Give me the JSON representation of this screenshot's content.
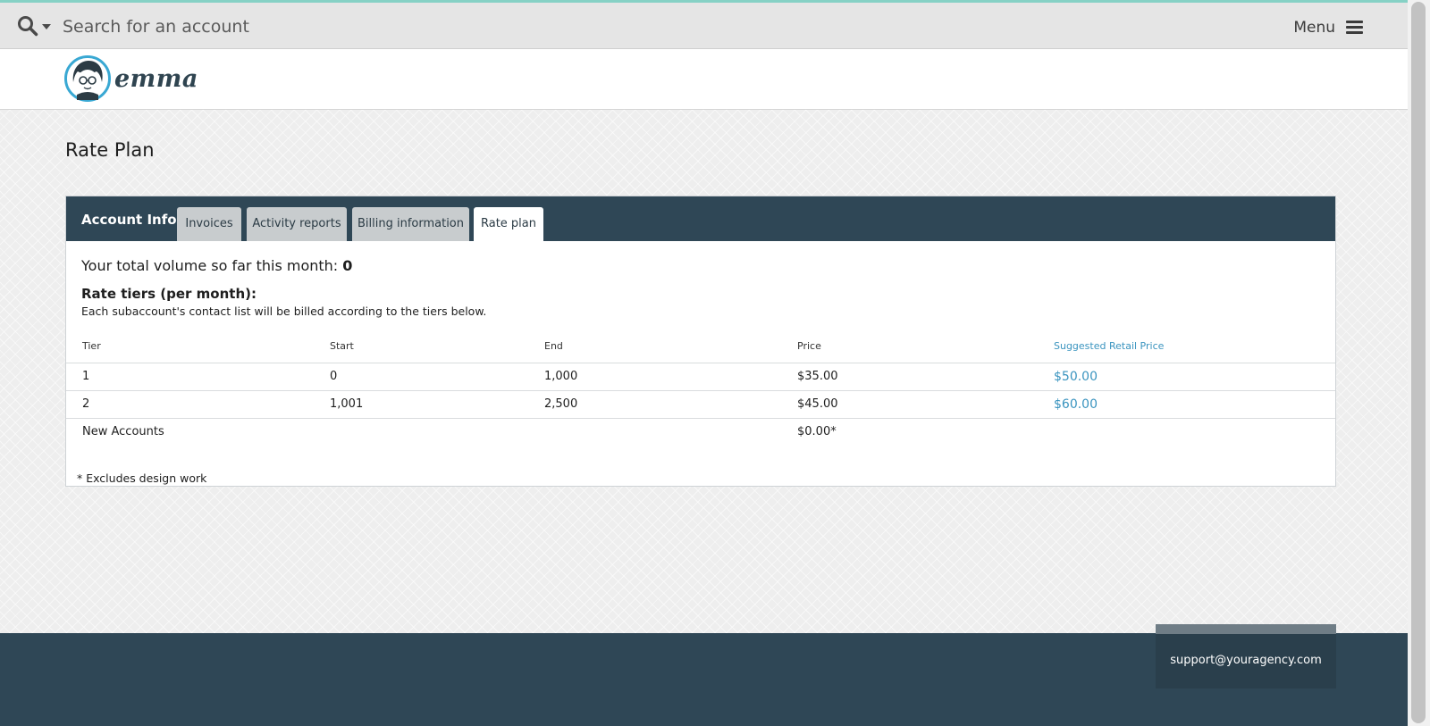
{
  "search": {
    "placeholder": "Search for an account",
    "icon": "search-icon"
  },
  "menu": {
    "label": "Menu",
    "icon": "hamburger-icon"
  },
  "brand": {
    "wordmark": "emma",
    "logo_icon": "emma-mascot-icon"
  },
  "page": {
    "title": "Rate Plan"
  },
  "panel": {
    "heading": "Account Info",
    "tabs": [
      {
        "label": "Invoices",
        "active": false
      },
      {
        "label": "Activity reports",
        "active": false
      },
      {
        "label": "Billing information",
        "active": false
      },
      {
        "label": "Rate plan",
        "active": true
      }
    ],
    "volume_label": "Your total volume so far this month:",
    "volume_value": "0",
    "tiers_heading": "Rate tiers (per month):",
    "tiers_description": "Each subaccount's contact list will be billed according to the tiers below.",
    "table": {
      "columns": [
        "Tier",
        "Start",
        "End",
        "Price",
        "Suggested Retail Price"
      ],
      "rows": [
        {
          "tier": "1",
          "start": "0",
          "end": "1,000",
          "price": "$35.00",
          "retail": "$50.00"
        },
        {
          "tier": "2",
          "start": "1,001",
          "end": "2,500",
          "price": "$45.00",
          "retail": "$60.00"
        },
        {
          "tier": "New Accounts",
          "start": "",
          "end": "",
          "price": "$0.00*",
          "retail": ""
        }
      ]
    },
    "footnote": "* Excludes design work"
  },
  "footer": {
    "support_email": "support@youragency.com"
  },
  "colors": {
    "accent_top": "#86d1c5",
    "panel_header": "#2f4756",
    "link": "#3a94bf",
    "footer": "#2f4756"
  }
}
